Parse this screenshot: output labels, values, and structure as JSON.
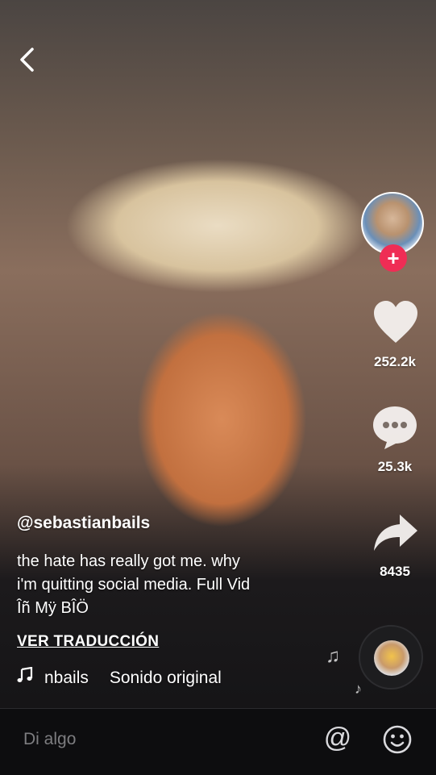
{
  "video": {
    "username": "@sebastianbails",
    "caption_line1": "the hate has really got me. why",
    "caption_line2": "i'm quitting social media. Full Vid",
    "caption_line3": "Îñ Mÿ BÎÖ",
    "translate_label": "VER TRADUCCIÓN",
    "sound_prefix": "nbails",
    "sound_name": "Sonido original"
  },
  "actions": {
    "likes": "252.2k",
    "comments": "25.3k",
    "shares": "8435"
  },
  "bottom_bar": {
    "comment_placeholder": "Di algo"
  },
  "colors": {
    "follow_plus": "#ef2d55",
    "icon_white": "#ffffff",
    "bar_background": "#0d0d0f"
  },
  "icons": [
    "back-chevron-icon",
    "heart-icon",
    "comment-bubble-icon",
    "share-arrow-icon",
    "music-note-icon",
    "at-icon",
    "emoji-icon"
  ]
}
